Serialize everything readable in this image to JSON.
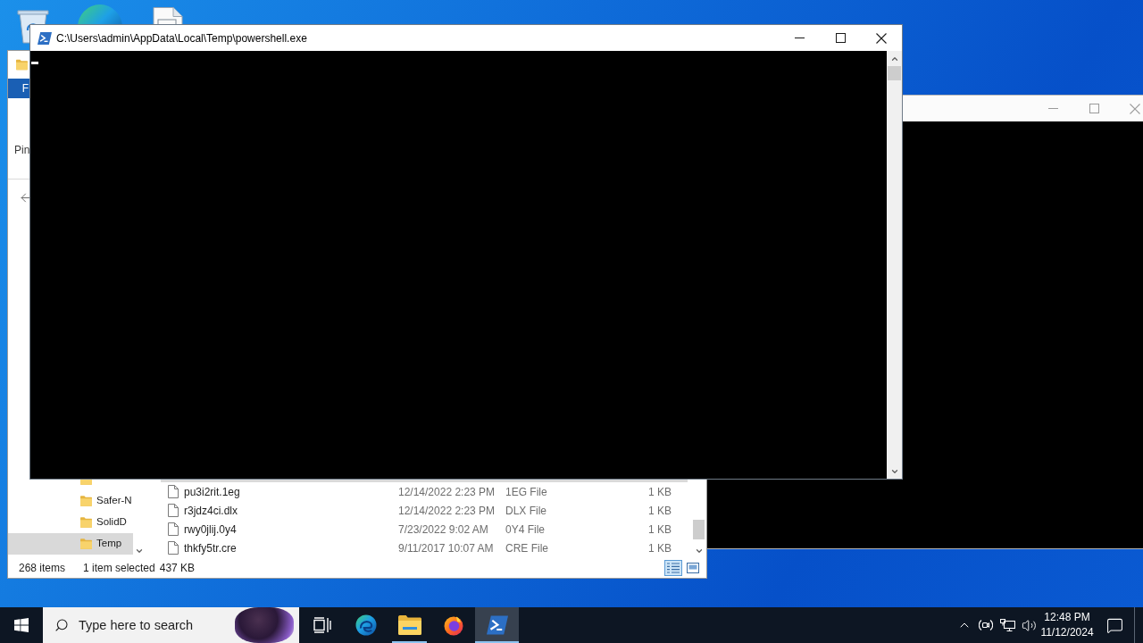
{
  "console_window": {
    "active": false
  },
  "explorer_window": {
    "ribbon": {
      "tab": "F",
      "command": "Pin"
    },
    "nav_pane": {
      "items": [
        {
          "label": "Safer-N",
          "selected": false
        },
        {
          "label": "SolidD",
          "selected": false
        },
        {
          "label": "Temp",
          "selected": true
        }
      ]
    },
    "files": [
      {
        "name": "pu3i2rit.1eg",
        "date": "12/14/2022 2:23 PM",
        "type": "1EG File",
        "size": "1 KB"
      },
      {
        "name": "r3jdz4ci.dlx",
        "date": "12/14/2022 2:23 PM",
        "type": "DLX File",
        "size": "1 KB"
      },
      {
        "name": "rwy0jlij.0y4",
        "date": "7/23/2022 9:02 AM",
        "type": "0Y4 File",
        "size": "1 KB"
      },
      {
        "name": "thkfy5tr.cre",
        "date": "9/11/2017 10:07 AM",
        "type": "CRE File",
        "size": "1 KB"
      }
    ],
    "status_bar": {
      "item_count": "268 items",
      "selection": "1 item selected",
      "selection_size": "437 KB",
      "views": [
        {
          "kind": "details",
          "selected": true
        },
        {
          "kind": "large-icons",
          "selected": false
        }
      ]
    }
  },
  "powershell_window": {
    "title": "C:\\Users\\admin\\AppData\\Local\\Temp\\powershell.exe",
    "active": true
  },
  "taskbar": {
    "search": {
      "placeholder": "Type here to search"
    },
    "apps": [
      {
        "kind": "task-view",
        "running": false,
        "selected": false
      },
      {
        "kind": "edge",
        "running": false,
        "selected": false
      },
      {
        "kind": "file-explorer",
        "running": true,
        "selected": false
      },
      {
        "kind": "firefox",
        "running": false,
        "selected": false
      },
      {
        "kind": "powershell",
        "running": true,
        "selected": true
      }
    ],
    "clock": {
      "time": "12:48 PM",
      "date": "11/12/2024"
    }
  }
}
